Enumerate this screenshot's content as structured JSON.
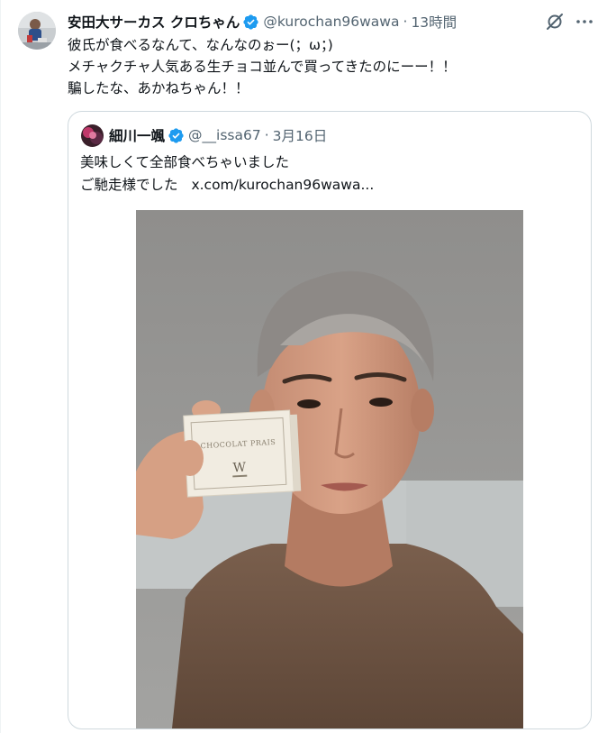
{
  "tweet": {
    "display_name": "安田大サーカス クロちゃん",
    "handle": "@kurochan96wawa",
    "separator": "·",
    "time": "13時間",
    "lines": [
      "彼氏が食べるなんて、なんなのぉー(；ω；)",
      "メチャクチャ人気ある生チョコ並んで買ってきたのにーー！！",
      "騙したな、あかねちゃん！！"
    ]
  },
  "quote": {
    "display_name": "細川一颯",
    "handle": "@__issa67",
    "separator": "·",
    "date": "3月16日",
    "line1": "美味しくて全部食べちゃいました",
    "line2_prefix": "ご馳走様でした",
    "link": "x.com/kurochan96wawa..."
  },
  "photo": {
    "box_label": "CHOCOLAT PRAIS"
  },
  "icons": {
    "verified": "verified-badge-icon",
    "grok": "grok-icon",
    "more": "more-icon"
  },
  "colors": {
    "text": "#0f1419",
    "muted": "#536471",
    "verified": "#1d9bf0",
    "border": "#cfd9de"
  }
}
